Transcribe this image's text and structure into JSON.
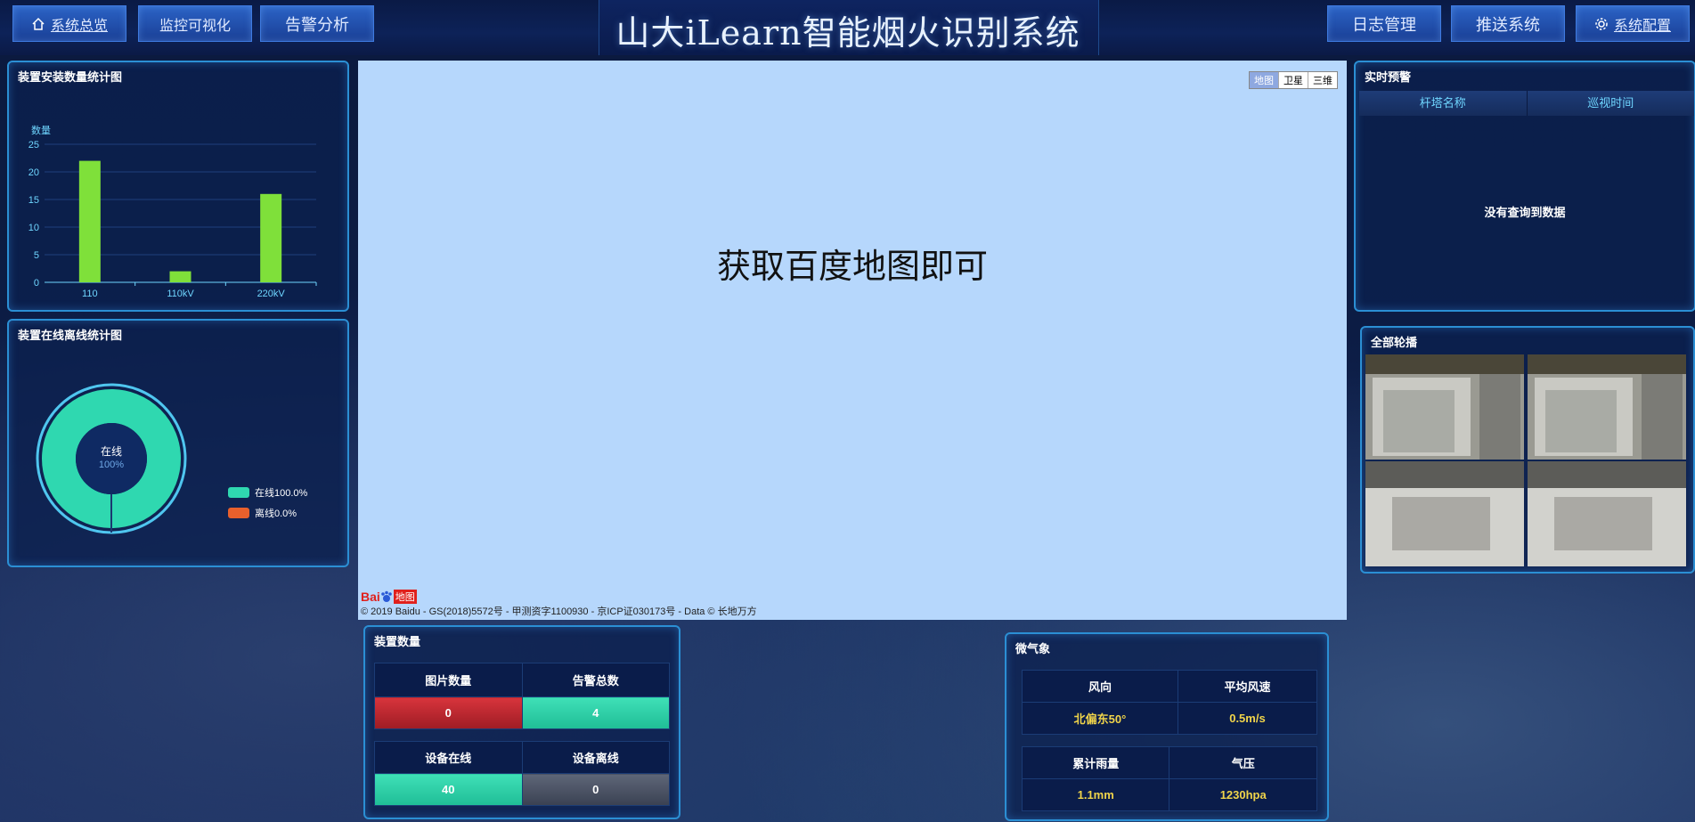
{
  "header": {
    "title": "山大iLearn智能烟火识别系统",
    "nav_left": [
      "系统总览",
      "监控可视化",
      "告警分析"
    ],
    "nav_right": [
      "日志管理",
      "推送系统",
      "系统配置"
    ]
  },
  "install_panel": {
    "title": "装置安装数量统计图",
    "chart_data": {
      "type": "bar",
      "categories": [
        "110",
        "110kV",
        "220kV"
      ],
      "values": [
        22,
        2,
        16
      ],
      "ylabel": "数量",
      "ylim": [
        0,
        25
      ],
      "yticks": [
        0,
        5,
        10,
        15,
        20,
        25
      ],
      "color": "#7fe03a"
    }
  },
  "online_panel": {
    "title": "装置在线离线统计图",
    "center_label": "在线",
    "center_value": "100%",
    "chart_data": {
      "type": "pie",
      "series": [
        {
          "name": "在线",
          "value": 100.0,
          "color": "#2fd8b0"
        },
        {
          "name": "离线",
          "value": 0.0,
          "color": "#e8602c"
        }
      ]
    },
    "legend": [
      "在线100.0%",
      "离线0.0%"
    ]
  },
  "map": {
    "placeholder_text": "获取百度地图即可",
    "map_types": [
      "地图",
      "卫星",
      "三维"
    ],
    "copyright": "© 2019 Baidu - GS(2018)5572号 - 甲测资字1100930 - 京ICP证030173号 - Data © 长地万方",
    "logo_text": "Bai",
    "logo_text2": "地图"
  },
  "alert_panel": {
    "title": "实时预警",
    "columns": [
      "杆塔名称",
      "巡视时间"
    ],
    "empty_text": "没有查询到数据"
  },
  "carousel_panel": {
    "title": "全部轮播"
  },
  "device_count": {
    "title": "装置数量",
    "row1_headers": [
      "图片数量",
      "告警总数"
    ],
    "row1_values": [
      "0",
      "4"
    ],
    "row2_headers": [
      "设备在线",
      "设备离线"
    ],
    "row2_values": [
      "40",
      "0"
    ]
  },
  "weather": {
    "title": "微气象",
    "row1_headers": [
      "风向",
      "平均风速"
    ],
    "row1_values": [
      "北偏东50°",
      "0.5m/s"
    ],
    "row2_headers": [
      "累计雨量",
      "气压"
    ],
    "row2_values": [
      "1.1mm",
      "1230hpa"
    ]
  }
}
